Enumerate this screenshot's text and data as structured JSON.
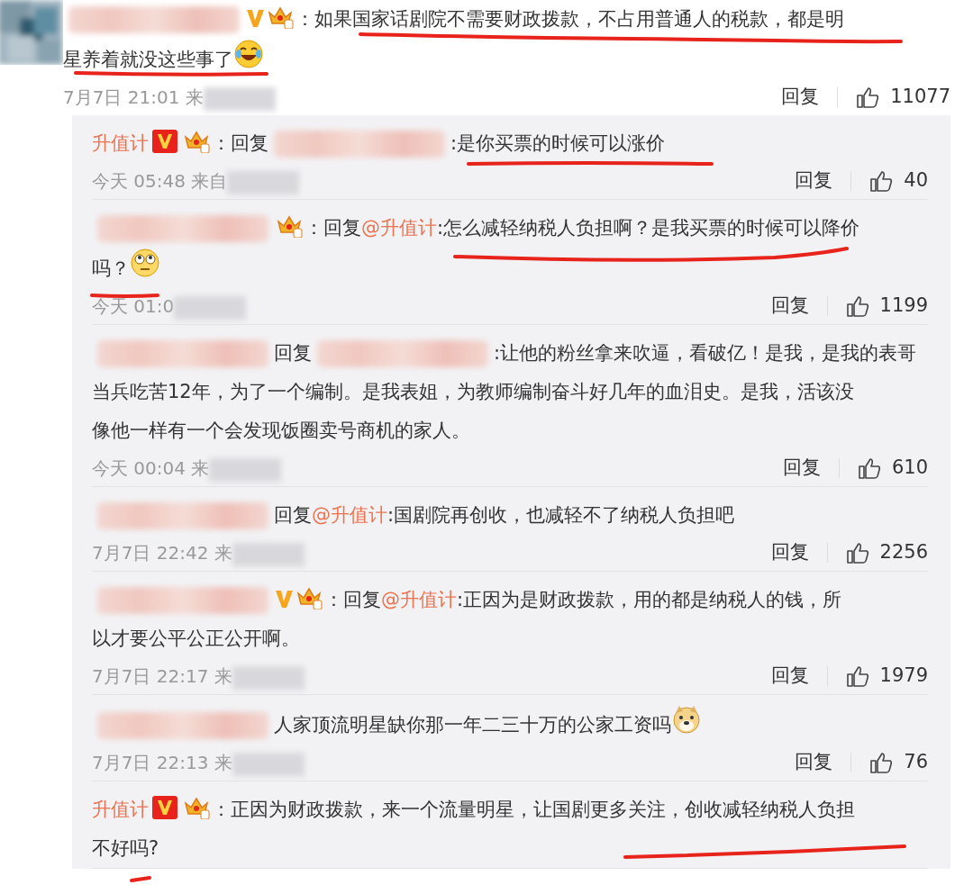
{
  "comment": {
    "segments": [
      {
        "kind": "redacted"
      },
      {
        "kind": "v-mark"
      },
      {
        "kind": "crown"
      },
      {
        "kind": "text",
        "lines": [
          "：如果国家话剧院不需要财政拨款，不占用普通人的税款，都是明",
          "星养着就没这些事了"
        ]
      },
      {
        "kind": "emoji-laugh"
      }
    ],
    "time": "7月7日 21:01 来",
    "reply_label": "回复",
    "likes": "11077"
  },
  "replies": [
    {
      "segments": [
        {
          "kind": "name",
          "text": "升值计"
        },
        {
          "kind": "v-badge"
        },
        {
          "kind": "crown"
        },
        {
          "kind": "text",
          "lines": [
            "：回复"
          ]
        },
        {
          "kind": "redacted"
        },
        {
          "kind": "text",
          "lines": [
            ":是你买票的时候可以涨价"
          ]
        }
      ],
      "time": "今天 05:48 来自",
      "reply_label": "回复",
      "likes": "40"
    },
    {
      "segments": [
        {
          "kind": "redacted"
        },
        {
          "kind": "crown"
        },
        {
          "kind": "text",
          "lines": [
            "：回复"
          ]
        },
        {
          "kind": "mention",
          "text": "@升值计"
        },
        {
          "kind": "text",
          "lines": [
            ":怎么减轻纳税人负担啊？是我买票的时候可以降价",
            "吗？"
          ]
        },
        {
          "kind": "emoji-eyes"
        }
      ],
      "time": "今天 01:0",
      "reply_label": "回复",
      "likes": "1199"
    },
    {
      "segments": [
        {
          "kind": "redacted"
        },
        {
          "kind": "text",
          "lines": [
            "回复"
          ]
        },
        {
          "kind": "redacted"
        },
        {
          "kind": "text",
          "lines": [
            ":让他的粉丝拿来吹逼，看破亿！是我，是我的表哥",
            "当兵吃苦12年，为了一个编制。是我表姐，为教师编制奋斗好几年的血泪史。是我，活该没",
            "像他一样有一个会发现饭圈卖号商机的家人。"
          ]
        }
      ],
      "time": "今天 00:04 来",
      "reply_label": "回复",
      "likes": "610"
    },
    {
      "segments": [
        {
          "kind": "redacted"
        },
        {
          "kind": "text",
          "lines": [
            "回复"
          ]
        },
        {
          "kind": "mention",
          "text": "@升值计"
        },
        {
          "kind": "text",
          "lines": [
            ":国剧院再创收，也减轻不了纳税人负担吧"
          ]
        }
      ],
      "time": "7月7日 22:42 来",
      "reply_label": "回复",
      "likes": "2256"
    },
    {
      "segments": [
        {
          "kind": "redacted"
        },
        {
          "kind": "v-mark"
        },
        {
          "kind": "crown"
        },
        {
          "kind": "text",
          "lines": [
            "：回复"
          ]
        },
        {
          "kind": "mention",
          "text": "@升值计"
        },
        {
          "kind": "text",
          "lines": [
            ":正因为是财政拨款，用的都是纳税人的钱，所",
            "以才要公平公正公开啊。"
          ]
        }
      ],
      "time": "7月7日 22:17 来",
      "reply_label": "回复",
      "likes": "1979"
    },
    {
      "segments": [
        {
          "kind": "redacted"
        },
        {
          "kind": "text",
          "lines": [
            "人家顶流明星缺你那一年二三十万的公家工资吗"
          ]
        },
        {
          "kind": "emoji-doge"
        }
      ],
      "time": "7月7日 22:13 来",
      "reply_label": "回复",
      "likes": "76"
    },
    {
      "segments": [
        {
          "kind": "name",
          "text": "升值计"
        },
        {
          "kind": "v-badge"
        },
        {
          "kind": "crown"
        },
        {
          "kind": "text",
          "lines": [
            "：正因为财政拨款，来一个流量明星，让国剧更多关注，创收减轻纳税人负担",
            "不好吗?"
          ]
        }
      ]
    }
  ]
}
